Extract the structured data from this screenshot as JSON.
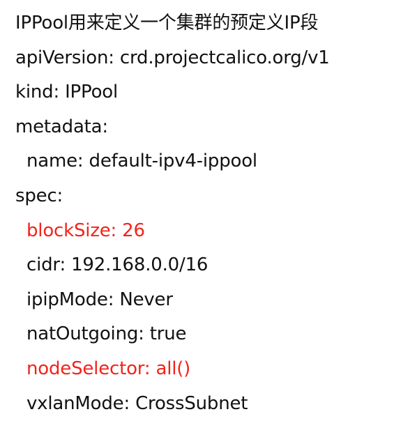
{
  "document": {
    "accent_color": "#f2231b",
    "title": "IPPool用来定义一个集群的预定义IP段",
    "lines": [
      "apiVersion: crd.projectcalico.org/v1",
      "kind: IPPool",
      "metadata:",
      "name: default-ipv4-ippool",
      "spec:",
      "blockSize: 26",
      "cidr: 192.168.0.0/16",
      "ipipMode: Never",
      "natOutgoing: true",
      "nodeSelector: all()",
      "vxlanMode: CrossSubnet"
    ]
  }
}
